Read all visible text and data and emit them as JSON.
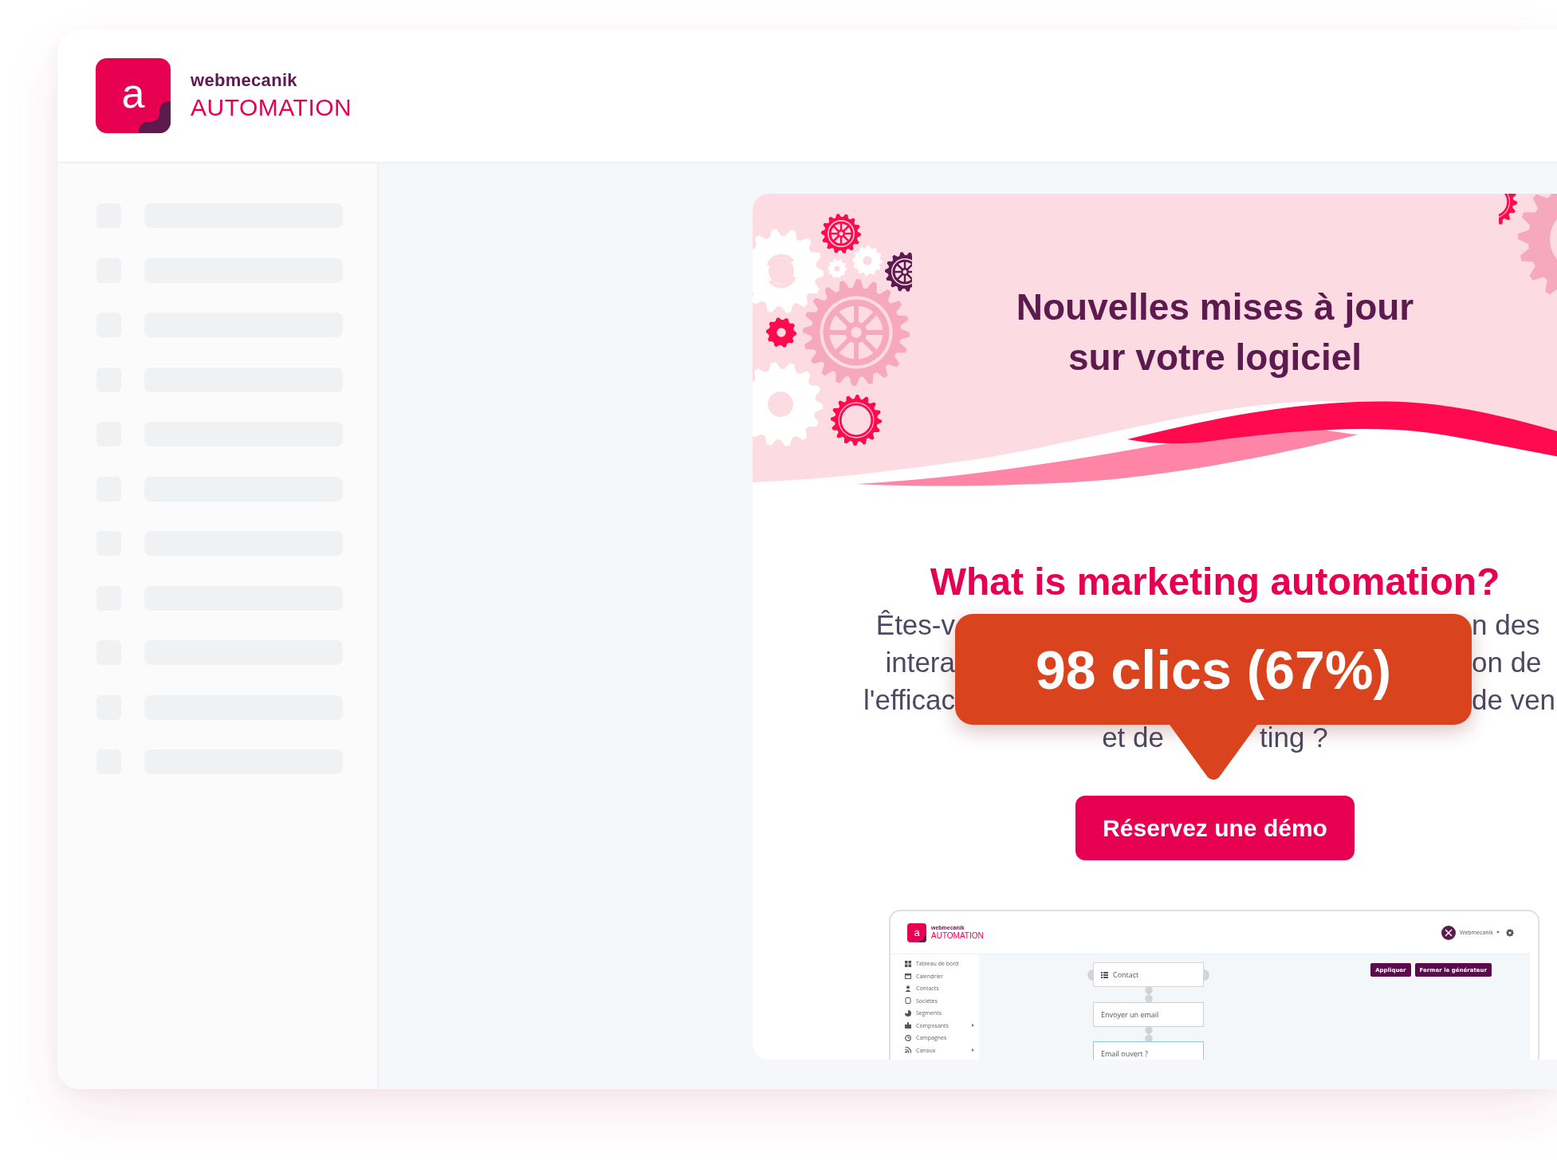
{
  "header": {
    "logo_letter": "a",
    "brand": "webmecanik",
    "product": "AUTOMATION"
  },
  "email": {
    "banner_title": [
      "Nouvelles mises à jour",
      "sur votre logiciel"
    ],
    "heading": "What is marketing automation?",
    "paragraph_lines": [
      {
        "left": "Êtes-v",
        "right": "n des"
      },
      {
        "left": "intera",
        "right": "on de"
      },
      {
        "left": "l'efficac",
        "right": "de ven"
      },
      {
        "left": "et de",
        "right": "ting ?"
      }
    ],
    "button": "Réservez une démo",
    "click_tooltip": "98 clics (67%)",
    "screenshot": {
      "logo_letter": "a",
      "brand": "webmecanik",
      "product": "AUTOMATION",
      "user": "Webmecanik",
      "menu": [
        {
          "label": "Tableau de bord",
          "submenu": false
        },
        {
          "label": "Calendrier",
          "submenu": false
        },
        {
          "label": "Contacts",
          "submenu": false
        },
        {
          "label": "Sociétés",
          "submenu": false
        },
        {
          "label": "Segments",
          "submenu": false
        },
        {
          "label": "Composants",
          "submenu": true
        },
        {
          "label": "Campagnes",
          "submenu": false
        },
        {
          "label": "Canaux",
          "submenu": true
        }
      ],
      "actions": [
        "Appliquer",
        "Fermer le générateur"
      ],
      "nodes": [
        {
          "label": "Contact",
          "kind": "source"
        },
        {
          "label": "Envoyer un email",
          "kind": "action"
        },
        {
          "label": "Email ouvert ?",
          "kind": "condition"
        }
      ]
    }
  }
}
